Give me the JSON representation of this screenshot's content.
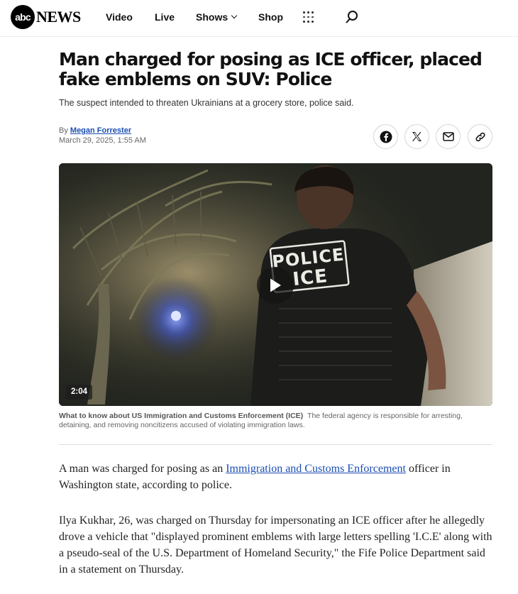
{
  "header": {
    "logo_abc": "abc",
    "logo_news": "NEWS",
    "nav": {
      "video": "Video",
      "live": "Live",
      "shows": "Shows",
      "shop": "Shop"
    },
    "icons": [
      "grid-menu-icon",
      "search-icon"
    ]
  },
  "article": {
    "headline": "Man charged for posing as ICE officer, placed fake emblems on SUV: Police",
    "subhead": "The suspect intended to threaten Ukrainians at a grocery store, police said.",
    "byline_prefix": "By ",
    "author": "Megan Forrester",
    "date": "March 29, 2025, 1:55 AM",
    "share_icons": [
      "facebook-icon",
      "x-icon",
      "mail-icon",
      "link-icon"
    ]
  },
  "video": {
    "duration": "2:04",
    "vest_line1": "POLICE",
    "vest_line2": "ICE",
    "caption_title": "What to know about US Immigration and Customs Enforcement (ICE)",
    "caption_text": "The federal agency is responsible for arresting, detaining, and removing noncitizens accused of violating immigration laws."
  },
  "body": {
    "p1_before": "A man was charged for posing as an ",
    "p1_link": "Immigration and Customs Enforcement",
    "p1_after": " officer in Washington state, according to police.",
    "p2": "Ilya Kukhar, 26, was charged on Thursday for impersonating an ICE officer after he allegedly drove a vehicle that \"displayed prominent emblems with large letters spelling 'I.C.E' along with a pseudo-seal of the U.S. Department of Homeland Security,\" the Fife Police Department said in a statement on Thursday."
  },
  "colors": {
    "link": "#1a4db3",
    "text": "#111111",
    "muted": "#666666"
  }
}
